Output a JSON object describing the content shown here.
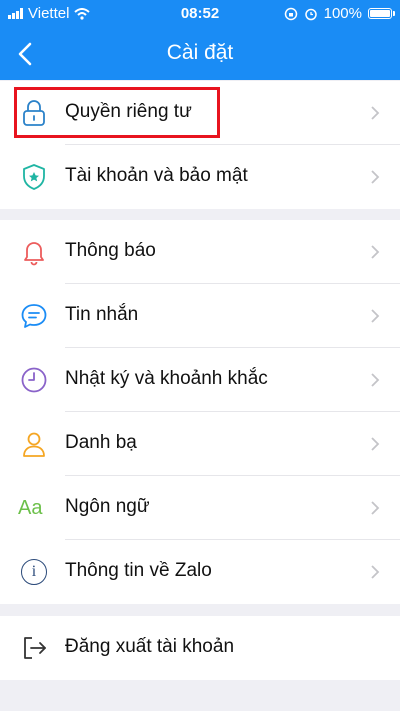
{
  "status_bar": {
    "carrier": "Viettel",
    "time": "08:52",
    "battery": "100%",
    "battery_level": 1.0
  },
  "header": {
    "title": "Cài đặt",
    "back_icon": "chevron-left-icon"
  },
  "groups": [
    {
      "items": [
        {
          "label": "Quyền riêng tư",
          "icon": "lock-icon",
          "highlighted": true
        },
        {
          "label": "Tài khoản và bảo mật",
          "icon": "shield-icon"
        }
      ]
    },
    {
      "items": [
        {
          "label": "Thông báo",
          "icon": "bell-icon"
        },
        {
          "label": "Tin nhắn",
          "icon": "message-icon"
        },
        {
          "label": "Nhật ký và khoảnh khắc",
          "icon": "clock-icon"
        },
        {
          "label": "Danh bạ",
          "icon": "contacts-icon"
        },
        {
          "label": "Ngôn ngữ",
          "icon": "language-icon",
          "icon_text": "Aa"
        },
        {
          "label": "Thông tin về Zalo",
          "icon": "info-icon",
          "icon_text": "i"
        }
      ]
    },
    {
      "items": [
        {
          "label": "Đăng xuất tài khoản",
          "icon": "logout-icon"
        }
      ]
    }
  ],
  "colors": {
    "accent": "#1a8cf5",
    "highlight": "#e8141f",
    "background": "#efeff4"
  }
}
